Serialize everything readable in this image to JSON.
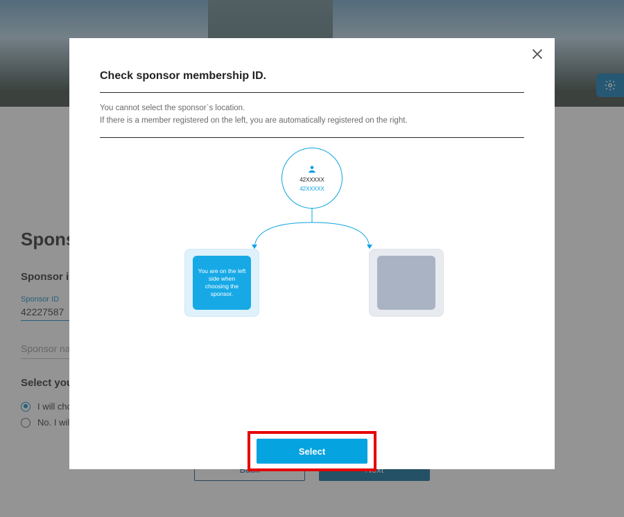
{
  "background": {
    "heading": "Sponsor",
    "sectionTitle": "Sponsor information",
    "sponsorIdLabel": "Sponsor ID",
    "sponsorIdValue": "42227587",
    "sponsorNamePlaceholder": "Sponsor name",
    "selectTitle": "Select your option",
    "radios": {
      "r1": "I will choose my sponsor",
      "r2": "No. I will not"
    },
    "backBtn": "Back",
    "nextBtn": "Next"
  },
  "modal": {
    "title": "Check sponsor membership ID.",
    "helperLine1": "You cannot select the sponsor`s location.",
    "helperLine2": "If there is a member registered on the left, you are automatically registered on the right.",
    "root": {
      "line1": "42XXXXX",
      "line2": "42XXXXX"
    },
    "leftSlotText": "You are on the left side when choosing the sponsor.",
    "selectBtn": "Select"
  }
}
